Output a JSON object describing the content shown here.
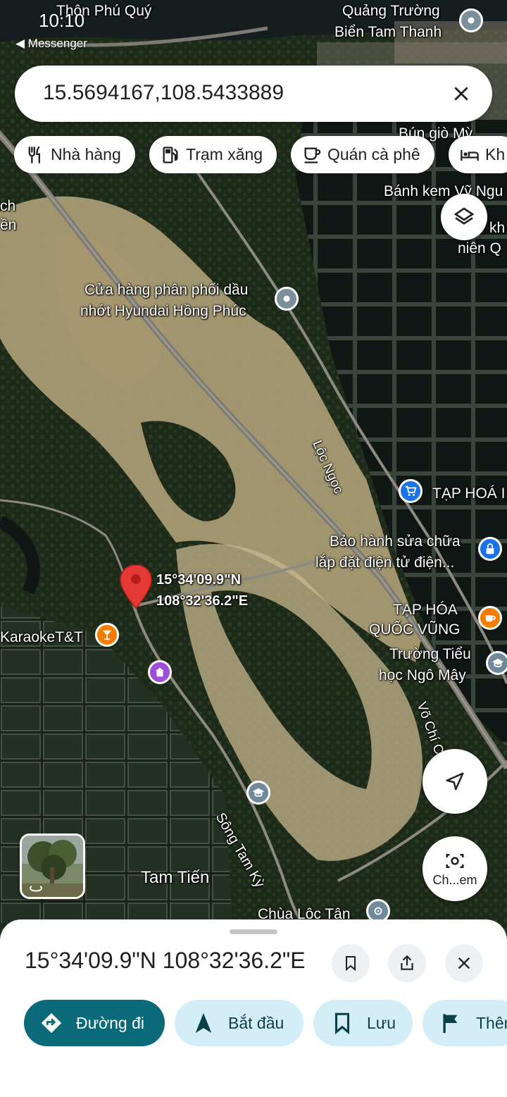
{
  "status_bar": {
    "time": "10:10",
    "back_app": "◀ Messenger"
  },
  "search": {
    "query": "15.5694167,108.5433889",
    "clear_icon": "close-icon"
  },
  "chips": [
    {
      "label": "Nhà hàng",
      "icon": "restaurant-icon"
    },
    {
      "label": "Trạm xăng",
      "icon": "gas-station-icon"
    },
    {
      "label": "Quán cà phê",
      "icon": "coffee-icon"
    },
    {
      "label": "Kh",
      "icon": "hotel-icon"
    }
  ],
  "map_labels": {
    "thon_phu_quy": "Thôn Phú Quý",
    "quang_truong_1": "Quảng Trường",
    "quang_truong_2": "Biển Tam Thanh",
    "bun_gio_1": "Bún giò  Mỳ",
    "banh_kem": "Bánh kem Vỹ Ngu",
    "nien_q": "niên Q",
    "kh_right": "kh",
    "ch_left_1": "ch",
    "ch_left_2": "ền",
    "store_1": "Cửa hàng phân phối dầu",
    "store_2": "nhớt Hyundai Hồng Phúc",
    "road_loc_ngoc": "Lộc Ngọc",
    "tap_hoa": "TẠP HOÁ I",
    "bao_hanh_1": "Bảo hành sửa chữa",
    "bao_hanh_2": "lắp đặt điện tử điện...",
    "coord_lat": "15°34'09.9\"N",
    "coord_lng": "108°32'36.2\"E",
    "karaoke": "KaraokeT&T",
    "tap_hoa_qv_1": "TẠP HÓA",
    "tap_hoa_qv_2": "QUỐC VŨNG",
    "truong_1": "Trường Tiểu",
    "truong_2": "học Ngô Mây",
    "vo_chi_cong": "Võ Chí C",
    "song_tam_ky": "Sông Tam Kỳ",
    "tam_tien": "Tam Tiến",
    "chua_loc_tan": "Chùa Lộc Tân"
  },
  "camera_button": {
    "label": "Ch...em"
  },
  "sheet": {
    "title": "15°34'09.9\"N 108°32'36.2\"E",
    "icons": [
      "bookmark-icon",
      "share-icon",
      "close-icon"
    ],
    "actions": [
      {
        "label": "Đường đi",
        "icon": "directions-icon"
      },
      {
        "label": "Bắt đầu",
        "icon": "navigation-icon"
      },
      {
        "label": "Lưu",
        "icon": "bookmark-icon"
      },
      {
        "label": "Thêm",
        "icon": "flag-icon"
      }
    ]
  },
  "colors": {
    "accent": "#0b6a7a",
    "action_bg": "#d3eef7",
    "pin_red": "#e53935",
    "poi_blue": "#1a73e8",
    "poi_orange": "#f57c00",
    "poi_purple": "#9c4ddb",
    "poi_grey": "#6f8a99"
  }
}
